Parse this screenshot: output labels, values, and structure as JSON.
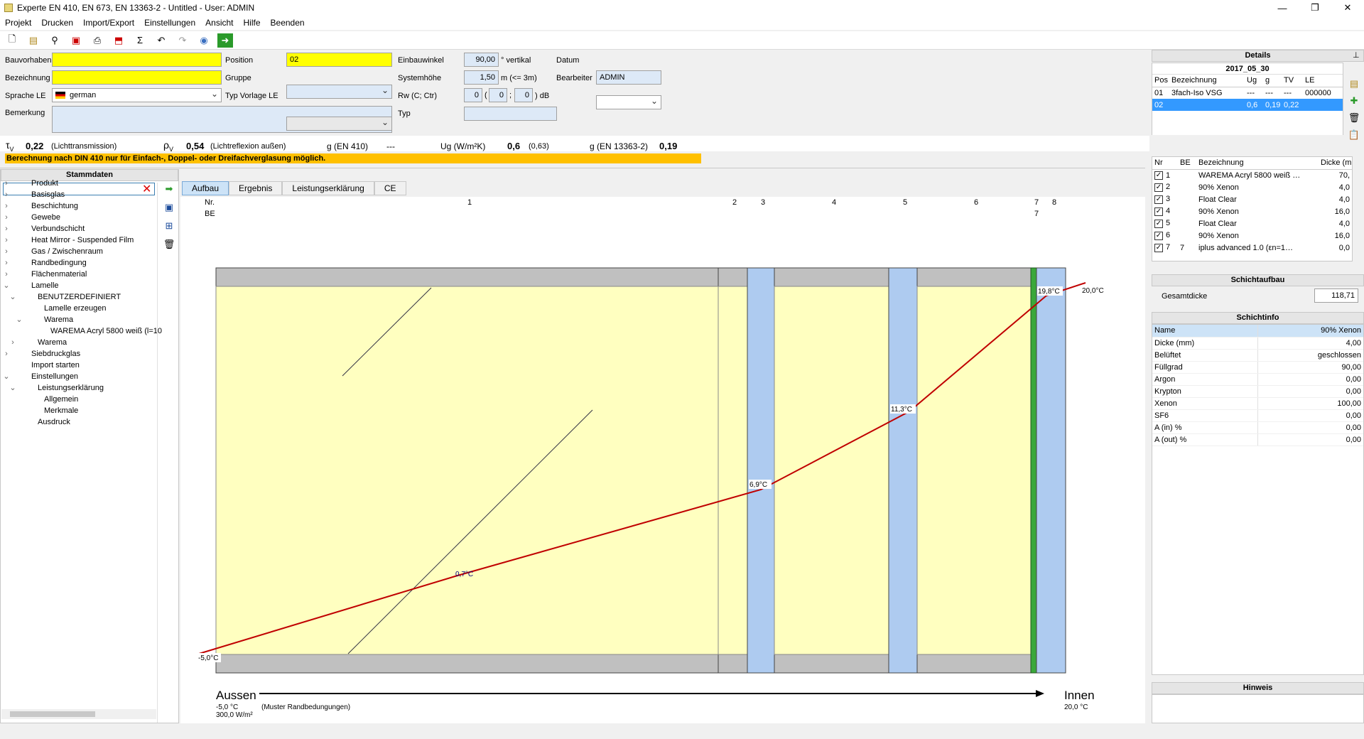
{
  "window": {
    "title": "Experte EN 410, EN 673, EN 13363-2 - Untitled - User: ADMIN"
  },
  "menu": [
    "Projekt",
    "Drucken",
    "Import/Export",
    "Einstellungen",
    "Ansicht",
    "Hilfe",
    "Beenden"
  ],
  "form": {
    "bauvorhaben_label": "Bauvorhaben",
    "bauvorhaben_value": "",
    "bezeichnung_label": "Bezeichnung",
    "bezeichnung_value": "",
    "sprache_label": "Sprache LE",
    "sprache_value": "german",
    "bemerkung_label": "Bemerkung",
    "position_label": "Position",
    "position_value": "02",
    "gruppe_label": "Gruppe",
    "typvorlage_label": "Typ Vorlage LE",
    "einbauwinkel_label": "Einbauwinkel",
    "einbauwinkel_value": "90,00",
    "einbauwinkel_unit": "° vertikal",
    "systemhoehe_label": "Systemhöhe",
    "systemhoehe_value": "1,50",
    "systemhoehe_unit": "m (<= 3m)",
    "rw_label": "Rw (C; Ctr)",
    "rw_value": "0",
    "rw_c": "0",
    "rw_ctr": "0",
    "rw_unit": "dB",
    "typ_label": "Typ",
    "datum_label": "Datum",
    "bearbeiter_label": "Bearbeiter",
    "bearbeiter_value": "ADMIN"
  },
  "results": {
    "tv_sym": "τ",
    "tv_sub": "V",
    "tv_value": "0,22",
    "tv_desc": "(Lichttransmission)",
    "rv_sym": "ρ",
    "rv_sub": "V",
    "rv_value": "0,54",
    "rv_desc": "(Lichtreflexion außen)",
    "g410_label": "g (EN 410)",
    "g410_value": "---",
    "ug_label": "Ug (W/m²K)",
    "ug_value": "0,6",
    "ug_extra": "(0,63)",
    "g13363_label": "g (EN 13363-2)",
    "g13363_value": "0,19",
    "warning": "Berechnung nach DIN 410 nur für Einfach-, Doppel- oder Dreifachverglasung möglich."
  },
  "stammdaten": {
    "title": "Stammdaten",
    "search": "",
    "items": [
      {
        "label": "Produkt",
        "level": 0,
        "exp": ">"
      },
      {
        "label": "Basisglas",
        "level": 0,
        "exp": ">"
      },
      {
        "label": "Beschichtung",
        "level": 0,
        "exp": ">"
      },
      {
        "label": "Gewebe",
        "level": 0,
        "exp": ">"
      },
      {
        "label": "Verbundschicht",
        "level": 0,
        "exp": ">"
      },
      {
        "label": "Heat Mirror - Suspended Film",
        "level": 0,
        "exp": ">"
      },
      {
        "label": "Gas / Zwischenraum",
        "level": 0,
        "exp": ">"
      },
      {
        "label": "Randbedingung",
        "level": 0,
        "exp": ">"
      },
      {
        "label": "Flächenmaterial",
        "level": 0,
        "exp": ">"
      },
      {
        "label": "Lamelle",
        "level": 0,
        "exp": "v"
      },
      {
        "label": "BENUTZERDEFINIERT",
        "level": 1,
        "exp": "v"
      },
      {
        "label": "Lamelle erzeugen",
        "level": 2,
        "exp": ""
      },
      {
        "label": "Warema",
        "level": 2,
        "exp": "v"
      },
      {
        "label": "WAREMA Acryl 5800 weiß (l=10",
        "level": 3,
        "exp": ""
      },
      {
        "label": "Warema",
        "level": 1,
        "exp": ">"
      },
      {
        "label": "Siebdruckglas",
        "level": 0,
        "exp": ">"
      },
      {
        "label": "Import starten",
        "level": 0,
        "exp": ""
      },
      {
        "label": "Einstellungen",
        "level": 0,
        "exp": "v"
      },
      {
        "label": "Leistungserklärung",
        "level": 1,
        "exp": "v"
      },
      {
        "label": "Allgemein",
        "level": 2,
        "exp": ""
      },
      {
        "label": "Merkmale",
        "level": 2,
        "exp": ""
      },
      {
        "label": "Ausdruck",
        "level": 1,
        "exp": ""
      }
    ]
  },
  "tabs": [
    "Aufbau",
    "Ergebnis",
    "Leistungserklärung",
    "CE"
  ],
  "diagram": {
    "nr_label": "Nr.",
    "be_label": "BE",
    "nr": [
      "1",
      "2",
      "3",
      "4",
      "5",
      "6",
      "7",
      "8"
    ],
    "be": [
      "7"
    ],
    "temps": [
      "-5,0°C",
      "0,7°C",
      "6,9°C",
      "11,3°C",
      "19,8°C",
      "20,0°C"
    ],
    "aussen": "Aussen",
    "aussen_temp": "-5,0 °C",
    "aussen_flux": "300,0 W/m²",
    "muster": "(Muster Randbedungungen)",
    "innen": "Innen",
    "innen_temp": "20,0 °C"
  },
  "details": {
    "title": "Details",
    "subtitle": "2017_05_30",
    "columns": [
      "Pos",
      "Bezeichnung",
      "Ug",
      "g",
      "TV",
      "LE"
    ],
    "rows": [
      {
        "pos": "01",
        "bez": "3fach-Iso VSG",
        "ug": "---",
        "g": "---",
        "tv": "---",
        "le": "000000"
      },
      {
        "pos": "02",
        "bez": "",
        "ug": "0,6",
        "g": "0,19",
        "tv": "0,22",
        "le": ""
      }
    ]
  },
  "layers": {
    "columns": [
      "Nr",
      "BE",
      "Bezeichnung",
      "Dicke (m"
    ],
    "rows": [
      {
        "nr": "1",
        "be": "",
        "bez": "WAREMA Acryl 5800 weiß …",
        "d": "70,"
      },
      {
        "nr": "2",
        "be": "",
        "bez": "90% Xenon",
        "d": "4,0"
      },
      {
        "nr": "3",
        "be": "",
        "bez": "Float Clear",
        "d": "4,0"
      },
      {
        "nr": "4",
        "be": "",
        "bez": "90% Xenon",
        "d": "16,0"
      },
      {
        "nr": "5",
        "be": "",
        "bez": "Float Clear",
        "d": "4,0"
      },
      {
        "nr": "6",
        "be": "",
        "bez": "90% Xenon",
        "d": "16,0"
      },
      {
        "nr": "7",
        "be": "7",
        "bez": "iplus advanced 1.0 (εn=1…",
        "d": "0,0"
      }
    ]
  },
  "schichtaufbau": {
    "title": "Schichtaufbau",
    "gesamt_label": "Gesamtdicke",
    "gesamt_value": "118,71"
  },
  "schichtinfo": {
    "title": "Schichtinfo",
    "rows": [
      {
        "k": "Name",
        "v": "90% Xenon"
      },
      {
        "k": "Dicke (mm)",
        "v": "4,00"
      },
      {
        "k": "Belüftet",
        "v": "geschlossen"
      },
      {
        "k": "Füllgrad",
        "v": "90,00"
      },
      {
        "k": "Argon",
        "v": "0,00"
      },
      {
        "k": "Krypton",
        "v": "0,00"
      },
      {
        "k": "Xenon",
        "v": "100,00"
      },
      {
        "k": "SF6",
        "v": "0,00"
      },
      {
        "k": "A (in) %",
        "v": "0,00"
      },
      {
        "k": "A (out) %",
        "v": "0,00"
      }
    ]
  },
  "hinweis": {
    "title": "Hinweis"
  },
  "colors": {
    "yellow": "#ffff00",
    "warning": "#ffc000",
    "glass": "#aecbf0",
    "slat_area": "#ffffc0",
    "curve": "#c00000"
  }
}
